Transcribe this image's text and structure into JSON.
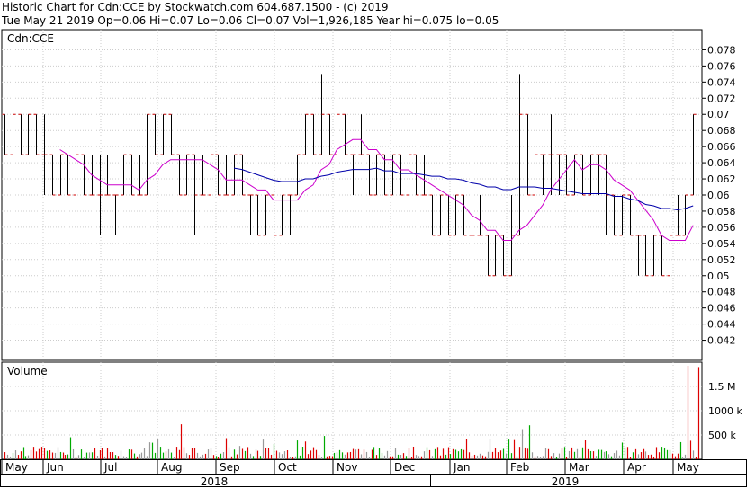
{
  "header": {
    "line1": "Historic Chart for Cdn:CCE by Stockwatch.com 604.687.1500 - (c) 2019",
    "line2": "Tue May 21 2019  Op=0.06  Hi=0.07  Lo=0.06  Cl=0.07  Vol=1,926,185  Year hi=0.075  lo=0.05"
  },
  "chart_data": {
    "type": "ohlc",
    "symbol_label": "Cdn:CCE",
    "volume_label": "Volume",
    "price_axis": {
      "range": [
        0.0395,
        0.0805
      ],
      "ticks": [
        0.078,
        0.076,
        0.074,
        0.072,
        0.07,
        0.068,
        0.066,
        0.064,
        0.062,
        0.06,
        0.058,
        0.056,
        0.054,
        0.052,
        0.05,
        0.048,
        0.046,
        0.044,
        0.042
      ],
      "tick_labels": [
        "0.078",
        "0.076",
        "0.074",
        "0.072",
        "0.07",
        "0.068",
        "0.066",
        "0.064",
        "0.062",
        "0.06",
        "0.058",
        "0.056",
        "0.054",
        "0.052",
        "0.05",
        "0.048",
        "0.046",
        "0.044",
        "0.042"
      ]
    },
    "volume_axis": {
      "range": [
        0,
        2000000
      ],
      "ticks": [
        1500000,
        1000000,
        500000
      ],
      "tick_labels": [
        "1.5 M",
        "1000 k",
        "500 k"
      ]
    },
    "months": [
      "May",
      "Jun",
      "Jul",
      "Aug",
      "Sep",
      "Oct",
      "Nov",
      "Dec",
      "Jan",
      "Feb",
      "Mar",
      "Apr",
      "May"
    ],
    "years": [
      "2018",
      "2019"
    ],
    "series": [
      {
        "name": "price bars",
        "approx_ohlc": [
          [
            0.07,
            0.07,
            0.065,
            0.065
          ],
          [
            0.065,
            0.07,
            0.065,
            0.07
          ],
          [
            0.07,
            0.07,
            0.065,
            0.065
          ],
          [
            0.065,
            0.07,
            0.065,
            0.07
          ],
          [
            0.07,
            0.07,
            0.065,
            0.065
          ],
          [
            0.065,
            0.07,
            0.06,
            0.065
          ],
          [
            0.065,
            0.065,
            0.06,
            0.06
          ],
          [
            0.06,
            0.065,
            0.06,
            0.065
          ],
          [
            0.065,
            0.065,
            0.06,
            0.06
          ],
          [
            0.06,
            0.065,
            0.06,
            0.065
          ],
          [
            0.065,
            0.065,
            0.06,
            0.06
          ],
          [
            0.06,
            0.065,
            0.06,
            0.06
          ],
          [
            0.06,
            0.065,
            0.055,
            0.06
          ],
          [
            0.06,
            0.065,
            0.06,
            0.06
          ],
          [
            0.06,
            0.06,
            0.055,
            0.06
          ],
          [
            0.06,
            0.065,
            0.06,
            0.065
          ],
          [
            0.065,
            0.065,
            0.06,
            0.06
          ],
          [
            0.06,
            0.065,
            0.06,
            0.06
          ],
          [
            0.06,
            0.07,
            0.06,
            0.07
          ],
          [
            0.07,
            0.07,
            0.065,
            0.065
          ],
          [
            0.065,
            0.07,
            0.065,
            0.07
          ],
          [
            0.07,
            0.07,
            0.065,
            0.065
          ],
          [
            0.065,
            0.065,
            0.06,
            0.06
          ],
          [
            0.06,
            0.065,
            0.06,
            0.065
          ],
          [
            0.065,
            0.065,
            0.055,
            0.06
          ],
          [
            0.06,
            0.065,
            0.06,
            0.06
          ],
          [
            0.06,
            0.065,
            0.06,
            0.065
          ],
          [
            0.065,
            0.065,
            0.06,
            0.06
          ],
          [
            0.06,
            0.065,
            0.06,
            0.06
          ],
          [
            0.06,
            0.065,
            0.06,
            0.065
          ],
          [
            0.065,
            0.065,
            0.06,
            0.06
          ],
          [
            0.06,
            0.06,
            0.055,
            0.06
          ],
          [
            0.06,
            0.06,
            0.055,
            0.055
          ],
          [
            0.055,
            0.06,
            0.055,
            0.06
          ],
          [
            0.06,
            0.06,
            0.055,
            0.055
          ],
          [
            0.055,
            0.06,
            0.055,
            0.06
          ],
          [
            0.06,
            0.06,
            0.055,
            0.06
          ],
          [
            0.06,
            0.065,
            0.06,
            0.065
          ],
          [
            0.065,
            0.07,
            0.065,
            0.07
          ],
          [
            0.07,
            0.07,
            0.065,
            0.065
          ],
          [
            0.065,
            0.075,
            0.065,
            0.07
          ],
          [
            0.07,
            0.07,
            0.065,
            0.065
          ],
          [
            0.065,
            0.07,
            0.065,
            0.07
          ],
          [
            0.07,
            0.07,
            0.065,
            0.065
          ],
          [
            0.065,
            0.065,
            0.06,
            0.065
          ],
          [
            0.065,
            0.07,
            0.065,
            0.065
          ],
          [
            0.065,
            0.065,
            0.06,
            0.06
          ],
          [
            0.06,
            0.065,
            0.06,
            0.065
          ],
          [
            0.065,
            0.065,
            0.06,
            0.06
          ],
          [
            0.06,
            0.065,
            0.06,
            0.065
          ],
          [
            0.065,
            0.065,
            0.06,
            0.06
          ],
          [
            0.06,
            0.065,
            0.06,
            0.065
          ],
          [
            0.065,
            0.065,
            0.06,
            0.06
          ],
          [
            0.06,
            0.065,
            0.06,
            0.06
          ],
          [
            0.06,
            0.06,
            0.055,
            0.055
          ],
          [
            0.055,
            0.06,
            0.055,
            0.06
          ],
          [
            0.06,
            0.06,
            0.055,
            0.055
          ],
          [
            0.055,
            0.06,
            0.055,
            0.06
          ],
          [
            0.06,
            0.06,
            0.055,
            0.055
          ],
          [
            0.055,
            0.055,
            0.05,
            0.055
          ],
          [
            0.055,
            0.06,
            0.055,
            0.055
          ],
          [
            0.055,
            0.055,
            0.05,
            0.05
          ],
          [
            0.05,
            0.055,
            0.05,
            0.055
          ],
          [
            0.055,
            0.055,
            0.05,
            0.05
          ],
          [
            0.05,
            0.06,
            0.05,
            0.055
          ],
          [
            0.055,
            0.075,
            0.055,
            0.07
          ],
          [
            0.07,
            0.07,
            0.06,
            0.06
          ],
          [
            0.06,
            0.065,
            0.055,
            0.065
          ],
          [
            0.065,
            0.065,
            0.06,
            0.065
          ],
          [
            0.065,
            0.07,
            0.06,
            0.065
          ],
          [
            0.065,
            0.065,
            0.06,
            0.065
          ],
          [
            0.065,
            0.065,
            0.06,
            0.06
          ],
          [
            0.06,
            0.065,
            0.06,
            0.065
          ],
          [
            0.065,
            0.065,
            0.06,
            0.06
          ],
          [
            0.06,
            0.065,
            0.06,
            0.065
          ],
          [
            0.065,
            0.065,
            0.06,
            0.065
          ],
          [
            0.065,
            0.065,
            0.055,
            0.06
          ],
          [
            0.06,
            0.06,
            0.055,
            0.055
          ],
          [
            0.055,
            0.06,
            0.055,
            0.06
          ],
          [
            0.06,
            0.06,
            0.055,
            0.055
          ],
          [
            0.055,
            0.055,
            0.05,
            0.055
          ],
          [
            0.055,
            0.055,
            0.05,
            0.05
          ],
          [
            0.05,
            0.055,
            0.05,
            0.055
          ],
          [
            0.055,
            0.055,
            0.05,
            0.05
          ],
          [
            0.05,
            0.055,
            0.05,
            0.055
          ],
          [
            0.055,
            0.06,
            0.055,
            0.055
          ],
          [
            0.055,
            0.06,
            0.055,
            0.06
          ],
          [
            0.06,
            0.07,
            0.06,
            0.07
          ]
        ]
      },
      {
        "name": "moving average (short)",
        "color": "#cc00cc"
      },
      {
        "name": "moving average (long)",
        "color": "#0000aa"
      }
    ],
    "volume_colors": {
      "up": "#00aa00",
      "down": "#dd0000",
      "flat": "#999999"
    },
    "grid": true
  }
}
